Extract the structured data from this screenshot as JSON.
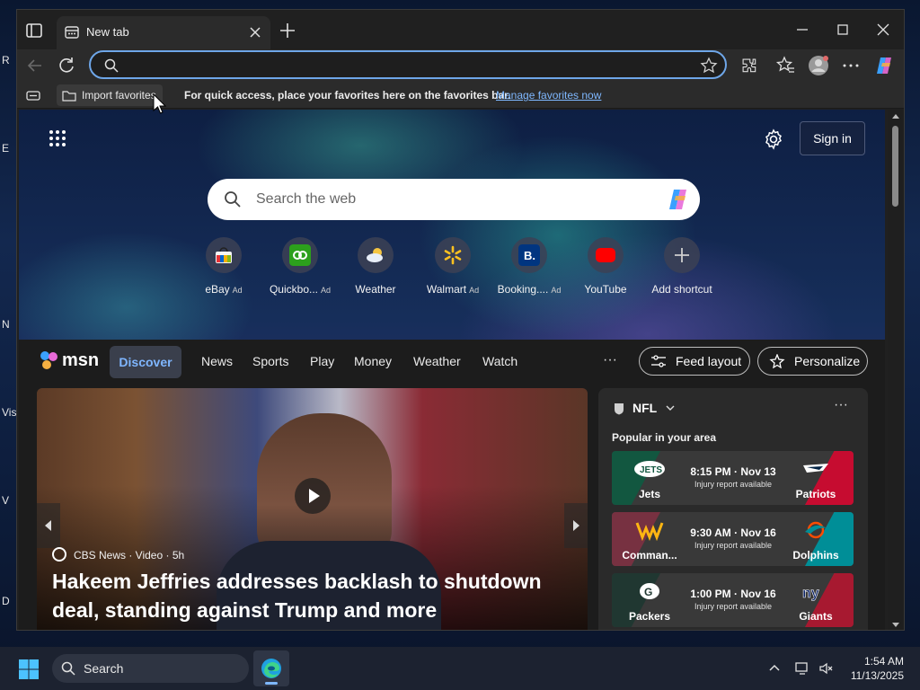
{
  "desktop": {
    "edge_fragments": [
      "R",
      "E",
      "N",
      "Vis",
      "V",
      "D"
    ]
  },
  "browser": {
    "tab": {
      "title": "New tab"
    },
    "address_bar": {
      "value": "",
      "placeholder": ""
    },
    "favorites_bar": {
      "import_label": "Import favorites",
      "message": "For quick access, place your favorites here on the favorites bar.",
      "manage_link": "Manage favorites now"
    }
  },
  "newtab": {
    "signin_label": "Sign in",
    "search": {
      "placeholder": "Search the web"
    },
    "shortcuts": [
      {
        "label": "eBay",
        "ad": "Ad",
        "icon": "ebay-icon",
        "color": "#e53238"
      },
      {
        "label": "Quickbo...",
        "ad": "Ad",
        "icon": "quickbooks-icon",
        "color": "#2ca01c"
      },
      {
        "label": "Weather",
        "ad": "",
        "icon": "weather-icon",
        "color": "#5aa0e8"
      },
      {
        "label": "Walmart",
        "ad": "Ad",
        "icon": "walmart-icon",
        "color": "#0071ce"
      },
      {
        "label": "Booking....",
        "ad": "Ad",
        "icon": "booking-icon",
        "color": "#003580"
      },
      {
        "label": "YouTube",
        "ad": "",
        "icon": "youtube-icon",
        "color": "#ff0000"
      },
      {
        "label": "Add shortcut",
        "ad": "",
        "icon": "plus-icon",
        "color": "#5a5f6e"
      }
    ]
  },
  "msn": {
    "logo": "msn",
    "tabs": [
      "Discover",
      "News",
      "Sports",
      "Play",
      "Money",
      "Weather",
      "Watch"
    ],
    "more": "···",
    "feed_layout_label": "Feed layout",
    "personalize_label": "Personalize",
    "hero": {
      "source": "CBS News · Video · 5h",
      "headline": "Hakeem Jeffries addresses backlash to shutdown deal, standing against Trump and more"
    },
    "nfl": {
      "title": "NFL",
      "subtitle": "Popular in your area",
      "games": [
        {
          "team_left": "Jets",
          "team_right": "Patriots",
          "time": "8:15 PM · Nov 13",
          "note": "Injury report available",
          "color_left": "#125740",
          "color_right": "#c60c30"
        },
        {
          "team_left": "Comman...",
          "team_right": "Dolphins",
          "time": "9:30 AM · Nov 16",
          "note": "Injury report available",
          "color_left": "#773141",
          "color_right": "#008e97"
        },
        {
          "team_left": "Packers",
          "team_right": "Giants",
          "time": "1:00 PM · Nov 16",
          "note": "Injury report available",
          "color_left": "#203731",
          "color_right": "#a71930"
        }
      ]
    }
  },
  "taskbar": {
    "search_label": "Search",
    "time": "1:54 AM",
    "date": "11/13/2025"
  },
  "colors": {
    "accent": "#7fb8ff",
    "address_border": "#6ea6e8"
  }
}
